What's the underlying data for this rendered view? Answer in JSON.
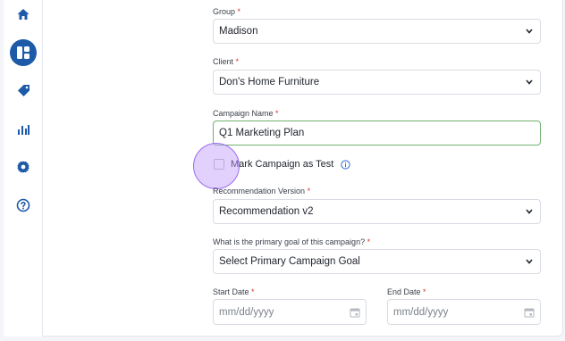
{
  "sidebar": {
    "items": [
      {
        "icon": "home-icon"
      },
      {
        "icon": "dashboard-icon"
      },
      {
        "icon": "tag-icon"
      },
      {
        "icon": "bar-chart-icon"
      },
      {
        "icon": "gear-icon"
      },
      {
        "icon": "help-icon"
      }
    ],
    "active_color": "#1d5aa8",
    "icon_color": "#1d5aa8"
  },
  "form": {
    "group": {
      "label": "Group",
      "value": "Madison"
    },
    "client": {
      "label": "Client",
      "value": "Don's Home Furniture"
    },
    "campaign_name": {
      "label": "Campaign Name",
      "value": "Q1 Marketing Plan"
    },
    "test_checkbox": {
      "label": "Mark Campaign as Test",
      "checked": false
    },
    "recommendation_version": {
      "label": "Recommendation Version",
      "value": "Recommendation v2"
    },
    "primary_goal": {
      "label": "What is the primary goal of this campaign?",
      "value": "Select Primary Campaign Goal"
    },
    "start_date": {
      "label": "Start Date",
      "placeholder": "mm/dd/yyyy"
    },
    "end_date": {
      "label": "End Date",
      "placeholder": "mm/dd/yyyy"
    },
    "required_mark": "*"
  },
  "colors": {
    "required": "#d9342b",
    "active_border": "#6fb26f",
    "touch_indicator": "#9b6cf2"
  }
}
